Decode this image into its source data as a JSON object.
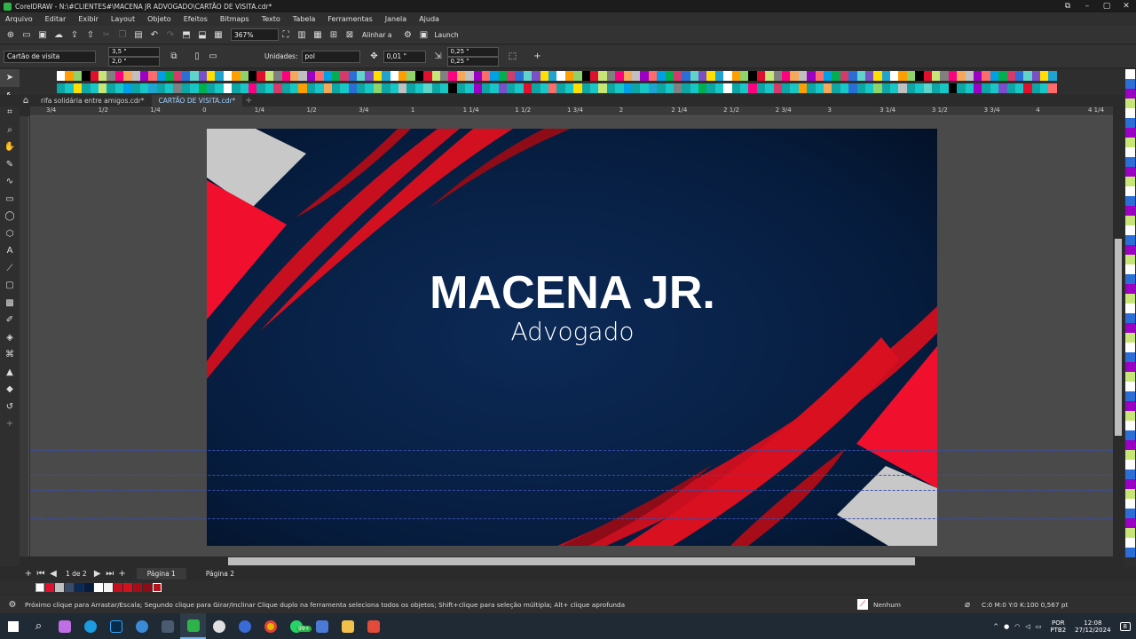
{
  "window": {
    "title": "CorelDRAW - N:\\#CLIENTES#\\MACENA JR ADVOGADO\\CARTÃO DE VISITA.cdr*"
  },
  "menu": [
    "Arquivo",
    "Editar",
    "Exibir",
    "Layout",
    "Objeto",
    "Efeitos",
    "Bitmaps",
    "Texto",
    "Tabela",
    "Ferramentas",
    "Janela",
    "Ajuda"
  ],
  "stdbar": {
    "zoom": "367%",
    "align_label": "Alinhar a",
    "launch_label": "Launch"
  },
  "propbar": {
    "preset": "Cartão de visita",
    "width": "3,5 \"",
    "height": "2,0 \"",
    "units_label": "Unidades:",
    "units_value": "pol",
    "nudge": "0,01 \"",
    "dup_x": "0,25 \"",
    "dup_y": "0,25 \""
  },
  "doctabs": [
    {
      "label": "rifa solidária entre amigos.cdr*"
    },
    {
      "label": "CARTÃO DE VISITA.cdr*"
    }
  ],
  "ruler_h": [
    "3/4",
    "1/2",
    "1/4",
    "0",
    "1/4",
    "1/2",
    "3/4",
    "1",
    "1 1/4",
    "1 1/2",
    "1 3/4",
    "2",
    "2 1/4",
    "2 1/2",
    "2 3/4",
    "3",
    "3 1/4",
    "3 1/2",
    "3 3/4",
    "4",
    "4 1/4"
  ],
  "card": {
    "title": "MACENA JR.",
    "subtitle": "Advogado",
    "colors": {
      "navy": "#0a2448",
      "red": "#e30f2e",
      "darkred": "#b5121b",
      "grey": "#c9c9c9"
    }
  },
  "pages": {
    "counter": "1 de 2",
    "tabs": [
      "Página 1",
      "Página 2"
    ]
  },
  "status": {
    "hint": "Próximo clique para Arrastar/Escala; Segundo clique para Girar/Inclinar Clique duplo na ferramenta seleciona todos os objetos; Shift+clique para seleção múltipla; Alt+ clique aprofunda",
    "fill_label": "Nenhum",
    "outline": "C:0 M:0 Y:0 K:100  0,567 pt"
  },
  "taskbar": {
    "lang1": "POR",
    "lang2": "PTB2",
    "time": "12:08",
    "date": "27/12/2024",
    "badge": "99+",
    "notif": "8"
  },
  "palette_colors": [
    "#ffffff",
    "#000000",
    "#808080",
    "#c0c0c0",
    "#00a0e6",
    "#2b6fd6",
    "#ffde00",
    "#ff9e00",
    "#e10f2d",
    "#ff0080",
    "#9b00c4",
    "#00b050",
    "#60d4c8",
    "#1fa4d2",
    "#8fd36a",
    "#c8e678",
    "#f5a85a",
    "#ff6a6a",
    "#d63a6a",
    "#7a4fc8"
  ]
}
